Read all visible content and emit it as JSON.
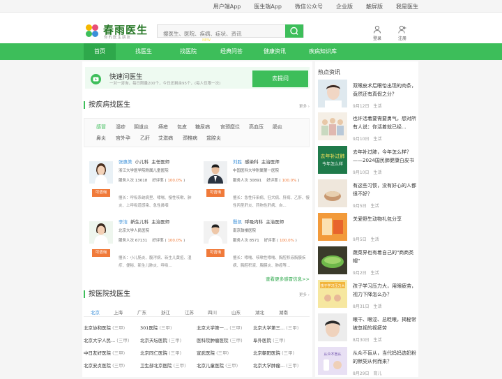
{
  "topbar": {
    "links": [
      "用户端App",
      "医生端App",
      "微信公众号",
      "企业版",
      "触屏版",
      "我是医生"
    ]
  },
  "header": {
    "logo_text": "春雨医生",
    "logo_subtitle": "你的医生朋友",
    "search_placeholder": "搜医生、医院、疾病、症状、资讯",
    "login_label": "登录",
    "register_label": "注册"
  },
  "nav": {
    "items": [
      "首页",
      "找医生",
      "找医院",
      "经典问答",
      "健康资讯",
      "疾病知识库"
    ],
    "new_badge": "NEW",
    "active_index": 0
  },
  "quick_ask": {
    "title": "快速问医生",
    "description": "一对一咨询，每日限量200个，今日还剩余95个，(每人仅限一次)",
    "button": "去提问"
  },
  "disease_section": {
    "title": "按疾病找医生",
    "more": "更多",
    "tags_row1": [
      "感冒",
      "湿疹",
      "阴道炎",
      "痔疮",
      "包皮",
      "糖尿病",
      "宫颈糜烂",
      "高血压",
      "肠炎"
    ],
    "tags_row2": [
      "鼻炎",
      "宫外孕",
      "乙肝",
      "艾滋病",
      "颈椎病",
      "盆腔炎"
    ],
    "selected_tag": "感冒",
    "consult_label": "可咨询",
    "service_label": "服务人次",
    "rating_label": "好评率",
    "doctors": [
      {
        "name": "张惠美",
        "dept": "小儿科",
        "title": "主任医师",
        "hospital": "浙江大学医学院附属儿童医院",
        "service_count": "13618",
        "rating": "100.0%",
        "desc": "擅长：呼吸系统病里、哮喘、慢性咳嗽、肺炎、上呼吸道感染、急性鼻咽"
      },
      {
        "name": "刘胜",
        "dept": "感染科",
        "title": "主治医师",
        "hospital": "中国医科大学附属第一医院",
        "service_count": "30891",
        "rating": "100.0%",
        "desc": "擅长：急性传染病、狂犬病、肝病、乙肝、慢性丙型肝炎、药物性肝病、自..."
      },
      {
        "name": "李洁",
        "dept": "新生儿科",
        "title": "主治医师",
        "hospital": "北京大学人民医院",
        "service_count": "67131",
        "rating": "100.0%",
        "desc": "擅长：小儿肠炎、腹泻病、新生儿黄疸、湿疹、便秘、新生儿肺炎、呼吸..."
      },
      {
        "name": "殷凯",
        "dept": "呼吸内科",
        "title": "主治医师",
        "hospital": "南京鼓楼医院",
        "service_count": "8571",
        "rating": "100.0%",
        "desc": "擅长：哮喘、咳嗽性哮喘、胸腔积液胸膜疾病、胸腔积液、胸膜炎、肺癌等..."
      }
    ],
    "sensitive_link": "查看更多感冒信息>>"
  },
  "hospital_section": {
    "title": "按医院找医生",
    "more": "更多",
    "cities": [
      "北京",
      "上海",
      "广东",
      "浙江",
      "江苏",
      "四川",
      "山东",
      "湖北",
      "湖南"
    ],
    "selected_city": "北京",
    "hospitals": [
      {
        "name": "北京协和医院",
        "level": "(三甲)"
      },
      {
        "name": "301医院",
        "level": "(三甲)"
      },
      {
        "name": "北京大学第一...",
        "level": "(三甲)"
      },
      {
        "name": "北京大学第三...",
        "level": "(三甲)"
      },
      {
        "name": "北京大学人民...",
        "level": "(三甲)"
      },
      {
        "name": "北京天坛医院",
        "level": "(三甲)"
      },
      {
        "name": "医科院肿瘤医院",
        "level": "(三甲)"
      },
      {
        "name": "阜外医院",
        "level": "(三甲)"
      },
      {
        "name": "中日友好医院",
        "level": "(三甲)"
      },
      {
        "name": "北京同仁医院",
        "level": "(三甲)"
      },
      {
        "name": "宣武医院",
        "level": "(三甲)"
      },
      {
        "name": "北京朝阳医院",
        "level": "(三甲)"
      },
      {
        "name": "北京安贞医院",
        "level": "(三甲)"
      },
      {
        "name": "卫生部北京医院",
        "level": "(三甲)"
      },
      {
        "name": "北京儿童医院",
        "level": "(三甲)"
      },
      {
        "name": "北京大学肿瘤...",
        "level": "(三甲)"
      }
    ]
  },
  "news": {
    "title": "热点资讯",
    "items": [
      {
        "title": "双眼皮术后眼怡出现的肉条，竟然还有真假之分？",
        "date": "9月12日",
        "category": "生活"
      },
      {
        "title": "也许活着要需要勇气，想对所有人说：你活着就已经...",
        "date": "9月10日",
        "category": "生活"
      },
      {
        "title": "去年补过肺，今年怎么样？——2024国民肺健康白皮书",
        "date": "9月10日",
        "category": "生活"
      },
      {
        "title": "有这些习惯，没有好心的人都很不好？",
        "date": "9月5日",
        "category": "生活"
      },
      {
        "title": "关爱野生动物礼包分享",
        "date": "9月5日",
        "category": "生活"
      },
      {
        "title": "蔬菜界也有着自己的\"商商类帽\"",
        "date": "9月2日",
        "category": "生活"
      },
      {
        "title": "孩子学习压力大，用眼疲劳，视力下降怎么办？",
        "date": "8月31日",
        "category": "生活"
      },
      {
        "title": "眼干、眼涩、总眨眼，揭秘常被忽视的视疲劳",
        "date": "8月30日",
        "category": "生活"
      },
      {
        "title": "从众不盲从，当代妈妈选奶粉的默契从何而来？",
        "date": "8月29日",
        "category": "育儿"
      }
    ],
    "thumb_texts": {
      "lung": "去年补过肺",
      "lung_sub": "今年怎么样",
      "kids": "孩子学习压力大",
      "milk": "从众不盲从"
    }
  }
}
